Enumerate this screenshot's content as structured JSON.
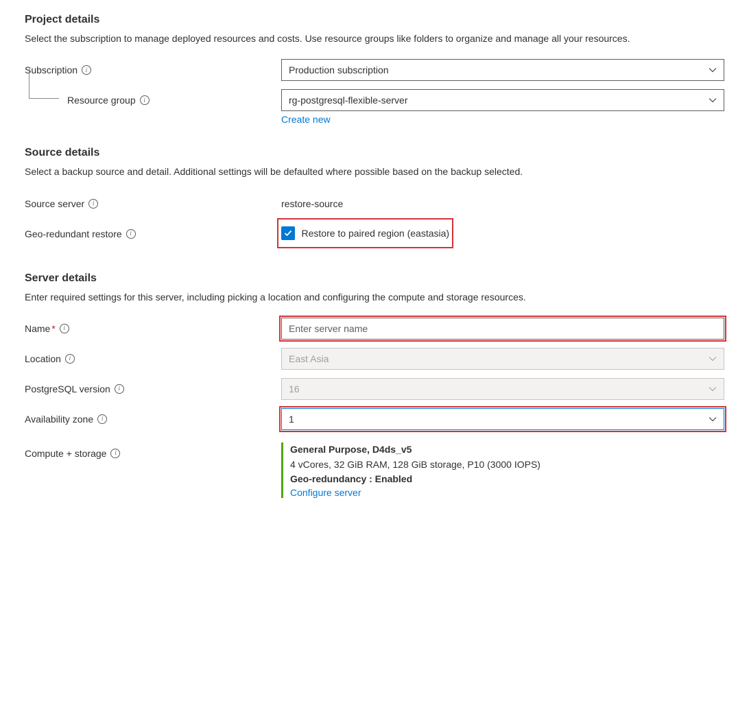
{
  "project": {
    "heading": "Project details",
    "description": "Select the subscription to manage deployed resources and costs. Use resource groups like folders to organize and manage all your resources.",
    "subscription_label": "Subscription",
    "subscription_value": "Production subscription",
    "resource_group_label": "Resource group",
    "resource_group_value": "rg-postgresql-flexible-server",
    "create_new_link": "Create new"
  },
  "source": {
    "heading": "Source details",
    "description": "Select a backup source and detail. Additional settings will be defaulted where possible based on the backup selected.",
    "source_server_label": "Source server",
    "source_server_value": "restore-source",
    "geo_restore_label": "Geo-redundant restore",
    "geo_restore_checkbox": "Restore to paired region (eastasia)"
  },
  "server": {
    "heading": "Server details",
    "description": "Enter required settings for this server, including picking a location and configuring the compute and storage resources.",
    "name_label": "Name",
    "name_placeholder": "Enter server name",
    "location_label": "Location",
    "location_value": "East Asia",
    "pg_version_label": "PostgreSQL version",
    "pg_version_value": "16",
    "az_label": "Availability zone",
    "az_value": "1",
    "compute_label": "Compute + storage",
    "compute_tier": "General Purpose, D4ds_v5",
    "compute_specs": "4 vCores, 32 GiB RAM, 128 GiB storage, P10 (3000 IOPS)",
    "compute_geo": "Geo-redundancy : Enabled",
    "configure_link": "Configure server"
  }
}
